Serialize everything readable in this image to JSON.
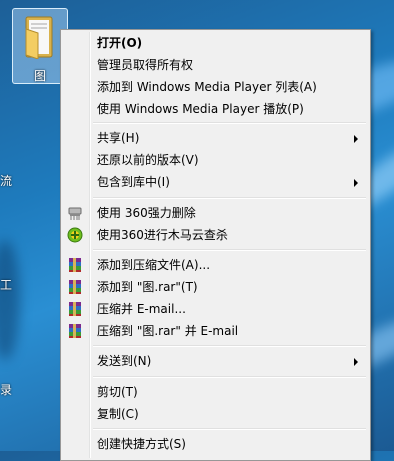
{
  "desktop": {
    "folder_label": "图",
    "edge_chars": [
      "流",
      "工",
      "录"
    ]
  },
  "context_menu": {
    "items": [
      {
        "label": "打开(O)",
        "bold": true
      },
      {
        "label": "管理员取得所有权"
      },
      {
        "label": "添加到 Windows Media Player 列表(A)"
      },
      {
        "label": "使用 Windows Media Player 播放(P)"
      },
      {
        "label": "共享(H)",
        "submenu": true
      },
      {
        "label": "还原以前的版本(V)"
      },
      {
        "label": "包含到库中(I)",
        "submenu": true
      },
      {
        "label": "使用 360强力删除",
        "icon": "shredder-icon"
      },
      {
        "label": "使用360进行木马云查杀",
        "icon": "360-security-icon"
      },
      {
        "label": "添加到压缩文件(A)...",
        "icon": "winrar-icon"
      },
      {
        "label": "添加到 \"图.rar\"(T)",
        "icon": "winrar-icon"
      },
      {
        "label": "压缩并 E-mail...",
        "icon": "winrar-icon"
      },
      {
        "label": "压缩到 \"图.rar\" 并 E-mail",
        "icon": "winrar-icon"
      },
      {
        "label": "发送到(N)",
        "submenu": true
      },
      {
        "label": "剪切(T)"
      },
      {
        "label": "复制(C)"
      },
      {
        "label": "创建快捷方式(S)"
      }
    ]
  }
}
